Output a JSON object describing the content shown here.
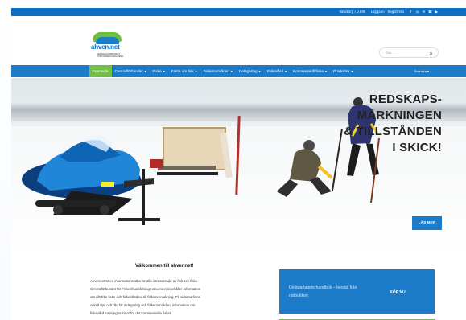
{
  "topbar": {
    "cart_text": "Varukorg / 0,00€",
    "account_text": "Logga in / Registrera",
    "social_icons": [
      "facebook-icon",
      "instagram-icon",
      "mail-icon",
      "phone-icon",
      "youtube-icon"
    ]
  },
  "header": {
    "logo_name": "ahven.net",
    "logo_sub1": "CENTRALFÖRBUNDET",
    "logo_sub2": "FÖR FISKEHUSHÅLLNING",
    "search_placeholder": "Sök..."
  },
  "nav": {
    "items": [
      {
        "label": "Framsida",
        "active": true,
        "caret": ""
      },
      {
        "label": "Centralförbundet",
        "active": false,
        "caret": "▾"
      },
      {
        "label": "Fiske",
        "active": false,
        "caret": "▾"
      },
      {
        "label": "Fakta om fisk",
        "active": false,
        "caret": "▾"
      },
      {
        "label": "Fiskeriområden",
        "active": false,
        "caret": "▾"
      },
      {
        "label": "Delägarlag",
        "active": false,
        "caret": "▾"
      },
      {
        "label": "Fiskevård",
        "active": false,
        "caret": "▾"
      },
      {
        "label": "Kommersiellt fiske",
        "active": false,
        "caret": "▾"
      },
      {
        "label": "Produkter",
        "active": false,
        "caret": "▾"
      }
    ],
    "language": "Svenska ▾"
  },
  "hero": {
    "headline_lines": [
      "REDSKAPS-",
      "MÄRKNINGEN",
      "& TILLSTÅNDEN",
      "I SKICK!"
    ],
    "read_more": "LÄS MER"
  },
  "content": {
    "welcome_title": "Välkommen till ahvennet!",
    "intro_lines": [
      "Ahvennet är en informationskälla för alla intresserade av fisk och fiske.",
      "Centralförbundet för Fiskerihushållnings ahvennet innehåller information",
      "om allt från fiske och fiskeitillstånd till fiskeövervakning. På sidorna finns",
      "också tips och råd för delägarlag och fiskeriområden, information om",
      "fiskevård samt egna sidor för det kommersiella fisket."
    ]
  },
  "promo": {
    "text": "Delägarlagets handbok – beställ från nätbutiken",
    "button": "KÖP NU"
  },
  "colors": {
    "primary_blue": "#1d7cc9",
    "top_blue": "#0d70c2",
    "green": "#6cbf3f"
  }
}
